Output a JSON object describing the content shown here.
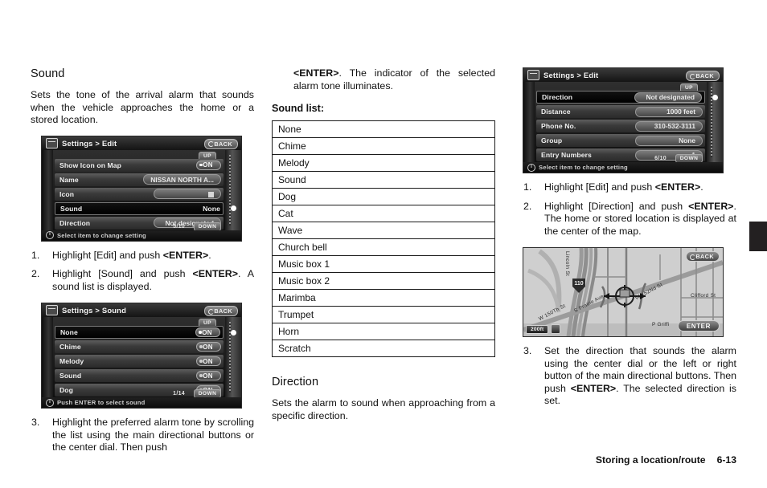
{
  "page": {
    "footer_title": "Storing a location/route",
    "footer_page": "6-13"
  },
  "col1": {
    "heading": "Sound",
    "intro": "Sets the tone of the arrival alarm that sounds when the vehicle approaches the home or a stored location.",
    "screen_edit": {
      "title": "Settings > Edit",
      "back_label": "BACK",
      "up_label": "UP",
      "down_label": "DOWN",
      "counter": "5/10",
      "status_icon": "info-icon",
      "status_text": "Select item to change setting",
      "rows": [
        {
          "label": "Show Icon on Map",
          "value": "ON",
          "kind": "toggle",
          "selected": false
        },
        {
          "label": "Name",
          "value": "NISSAN NORTH A...",
          "kind": "value",
          "selected": false
        },
        {
          "label": "Icon",
          "value": "",
          "kind": "icon",
          "selected": false
        },
        {
          "label": "Sound",
          "value": "None",
          "kind": "plain",
          "selected": true
        },
        {
          "label": "Direction",
          "value": "Not designated",
          "kind": "value",
          "selected": false
        }
      ]
    },
    "steps_a": [
      {
        "num": "1.",
        "pre": "Highlight [Edit] and push ",
        "bold": "<ENTER>",
        "post": "."
      },
      {
        "num": "2.",
        "pre": "Highlight [Sound] and push ",
        "bold": "<ENTER>",
        "post": ". A sound list is displayed."
      }
    ],
    "screen_sound": {
      "title": "Settings > Sound",
      "back_label": "BACK",
      "up_label": "UP",
      "down_label": "DOWN",
      "counter": "1/14",
      "status_icon": "info-icon",
      "status_text": "Push ENTER to select sound",
      "rows": [
        {
          "label": "None",
          "value": "ON",
          "selected": true
        },
        {
          "label": "Chime",
          "value": "ON",
          "selected": false
        },
        {
          "label": "Melody",
          "value": "ON",
          "selected": false
        },
        {
          "label": "Sound",
          "value": "ON",
          "selected": false
        },
        {
          "label": "Dog",
          "value": "ON",
          "selected": false
        }
      ]
    },
    "step3": {
      "num": "3.",
      "text": "Highlight the preferred alarm tone by scrolling the list using the main directional buttons or the center dial. Then push"
    }
  },
  "col2": {
    "continuation": {
      "bold": "<ENTER>",
      "text": ". The indicator of the selected alarm tone illuminates."
    },
    "list_title": "Sound list:",
    "sound_list": [
      "None",
      "Chime",
      "Melody",
      "Sound",
      "Dog",
      "Cat",
      "Wave",
      "Church bell",
      "Music box 1",
      "Music box 2",
      "Marimba",
      "Trumpet",
      "Horn",
      "Scratch"
    ],
    "direction_heading": "Direction",
    "direction_intro": "Sets the alarm to sound when approaching from a specific direction."
  },
  "col3": {
    "screen_edit2": {
      "title": "Settings > Edit",
      "back_label": "BACK",
      "up_label": "UP",
      "down_label": "DOWN",
      "counter": "6/10",
      "status_icon": "info-icon",
      "status_text": "Select item to change setting",
      "rows": [
        {
          "label": "Direction",
          "value": "Not designated",
          "selected": true
        },
        {
          "label": "Distance",
          "value": "1000 feet",
          "selected": false
        },
        {
          "label": "Phone No.",
          "value": "310-532-3111",
          "selected": false
        },
        {
          "label": "Group",
          "value": "None",
          "selected": false
        },
        {
          "label": "Entry Numbers",
          "value": "1",
          "selected": false
        }
      ]
    },
    "steps_a": [
      {
        "num": "1.",
        "pre": "Highlight [Edit] and push ",
        "bold": "<ENTER>",
        "post": "."
      },
      {
        "num": "2.",
        "pre": "Highlight [Direction] and push ",
        "bold": "<ENTER>",
        "post": ". The home or stored location is displayed at the center of the map."
      }
    ],
    "map": {
      "back_label": "BACK",
      "enter_label": "ENTER",
      "scale_label": "200ft",
      "scale_icon": "map-orientation-icon",
      "route_marker": "110",
      "labels": [
        "Lincoln St",
        "W 150Th St",
        "S Prairie Ave",
        "W 152Nd St",
        "Clifford St",
        "P Griffi"
      ]
    },
    "step3": {
      "num": "3.",
      "pre": "Set the direction that sounds the alarm using the center dial or the left or right button of the main directional buttons. Then push ",
      "bold": "<ENTER>",
      "post": ". The selected direction is set."
    }
  }
}
